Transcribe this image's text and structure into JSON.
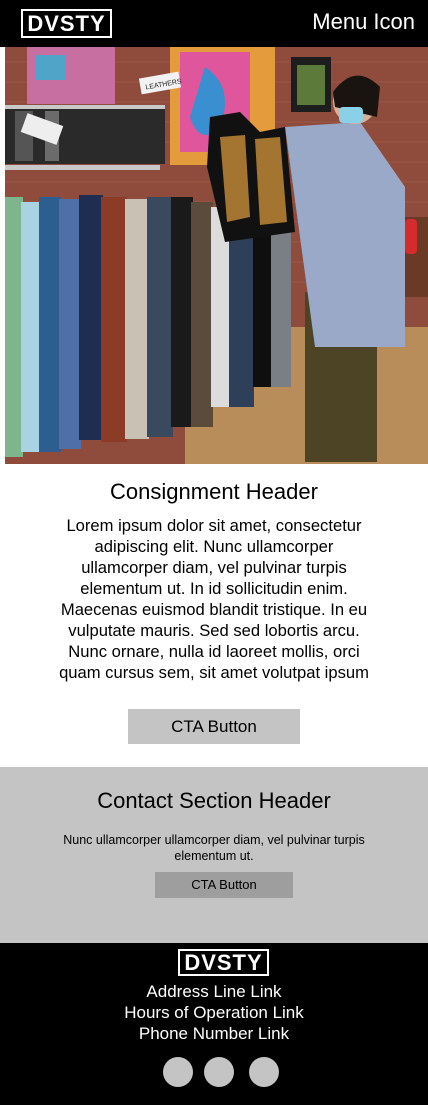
{
  "header": {
    "logo": "DVSTY",
    "menu_label": "Menu Icon"
  },
  "hero": {
    "sign_label": "LEATHERS",
    "colors": {
      "brick": "#8f4b3b",
      "floor": "#b98d5a",
      "rack": "#c9c9c9"
    }
  },
  "consignment": {
    "title": "Consignment Header",
    "body": "Lorem ipsum dolor sit amet, consectetur adipiscing elit. Nunc ullamcorper ullamcorper diam, vel pulvinar turpis elementum ut. In id sollicitudin enim. Maecenas euismod blandit tristique. In eu vulputate mauris. Sed sed lobortis arcu. Nunc ornare, nulla id laoreet mollis, orci quam cursus sem, sit amet volutpat ipsum",
    "cta_label": "CTA Button"
  },
  "contact": {
    "title": "Contact Section Header",
    "body": "Nunc ullamcorper ullamcorper diam, vel pulvinar turpis elementum ut.",
    "cta_label": "CTA Button"
  },
  "footer": {
    "logo": "DVSTY",
    "address_link": "Address Line Link",
    "hours_link": "Hours of Operation Link",
    "phone_link": "Phone Number Link",
    "social_icons": [
      "social-icon",
      "social-icon",
      "social-icon"
    ]
  },
  "colors": {
    "bar_bg": "#000000",
    "section_gray": "#c4c4c4",
    "button_gray": "#c4c4c4",
    "button_dark_gray": "#9e9e9e"
  }
}
